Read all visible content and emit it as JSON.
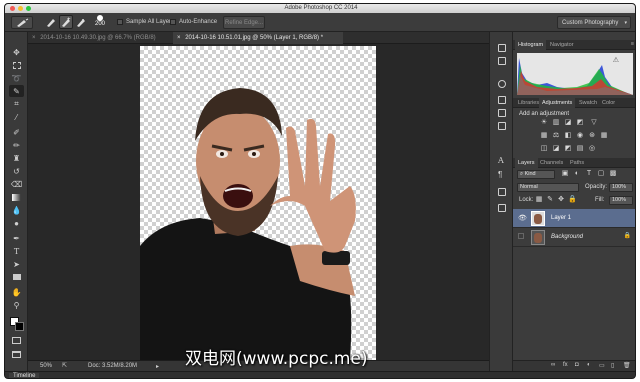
{
  "window": {
    "title": "Adobe Photoshop CC 2014"
  },
  "options_bar": {
    "brush_size": "200",
    "sample_all_layers_label": "Sample All Layers",
    "auto_enhance_label": "Auto-Enhance",
    "refine_edge_label": "Refine Edge...",
    "workspace_value": "Custom Photography"
  },
  "tools": [
    "move-tool-icon",
    "marquee-tool-icon",
    "lasso-tool-icon",
    "quick-selection-tool-icon",
    "crop-tool-icon",
    "eyedropper-tool-icon",
    "spot-healing-tool-icon",
    "brush-tool-icon",
    "clone-stamp-tool-icon",
    "history-brush-tool-icon",
    "eraser-tool-icon",
    "gradient-tool-icon",
    "blur-tool-icon",
    "dodge-tool-icon",
    "pen-tool-icon",
    "type-tool-icon",
    "path-selection-tool-icon",
    "rectangle-tool-icon",
    "hand-tool-icon",
    "zoom-tool-icon"
  ],
  "doc_tabs": [
    {
      "label": "2014-10-16 10.49.30.jpg @ 66.7% (RGB/8)",
      "active": false
    },
    {
      "label": "2014-10-16 10.51.01.jpg @ 50% (Layer 1, RGB/8) *",
      "active": true
    }
  ],
  "status": {
    "zoom": "50%",
    "doc_info": "Doc: 3.52M/8.20M"
  },
  "timeline_label": "Timeline",
  "histogram_panel": {
    "tabs": [
      "Histogram",
      "Navigator"
    ]
  },
  "adjustments_panel": {
    "tabs": [
      "Libraries",
      "Adjustments",
      "Swatch",
      "Color"
    ],
    "heading": "Add an adjustment"
  },
  "layers_panel": {
    "tabs": [
      "Layers",
      "Channels",
      "Paths"
    ],
    "filter_value": "Kind",
    "blend_mode": "Normal",
    "opacity_label": "Opacity:",
    "opacity_value": "100%",
    "lock_label": "Lock:",
    "fill_label": "Fill:",
    "fill_value": "100%",
    "layers": [
      {
        "name": "Layer 1",
        "selected": true
      },
      {
        "name": "Background",
        "selected": false
      }
    ]
  },
  "watermark": "双电网(www.pcpc.me)",
  "colors": {
    "panel_bg": "#3c3c3c",
    "selection": "#5b6d8f",
    "canvas_bg": "#282828"
  }
}
